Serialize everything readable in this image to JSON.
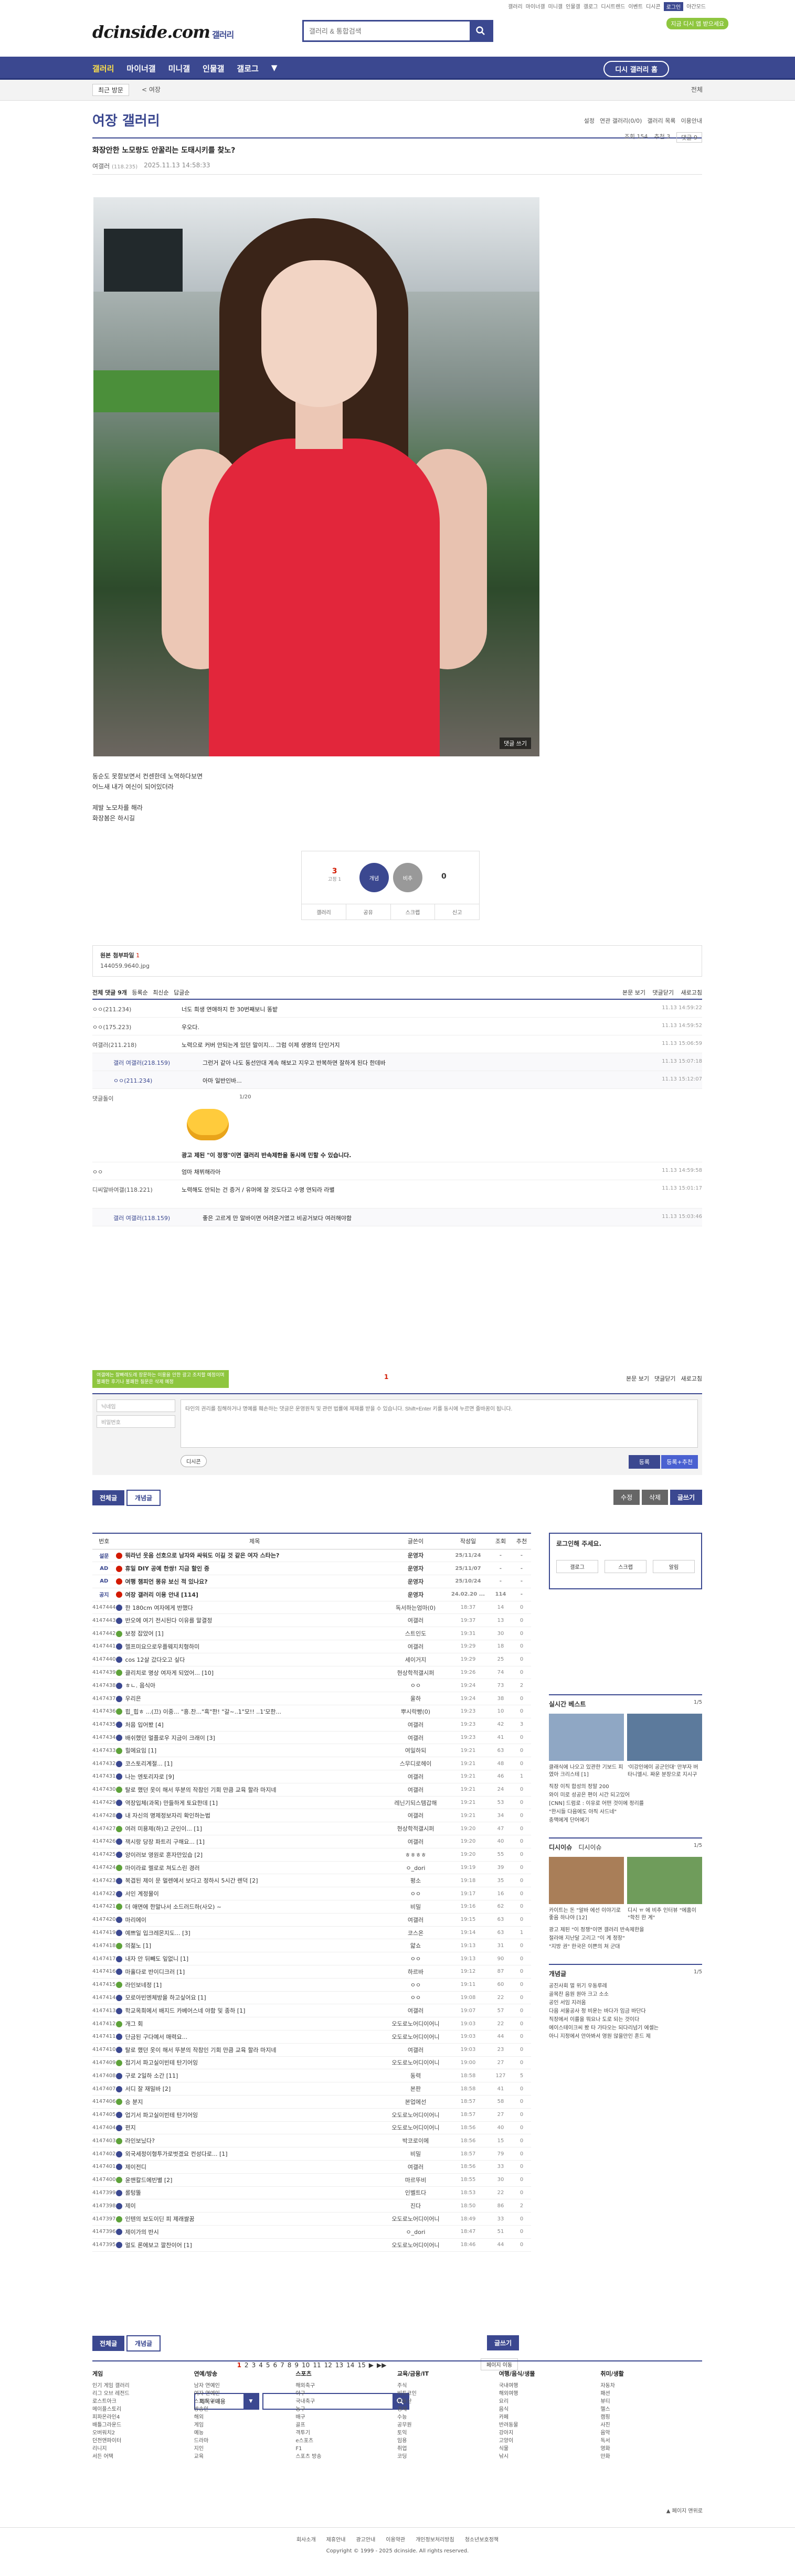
{
  "top": {
    "links": [
      "갤러리",
      "마이너갤",
      "미니갤",
      "인물갤",
      "갤로그",
      "디시트렌드",
      "이벤트",
      "디시콘",
      "로그인",
      "야간모드"
    ],
    "logo": "dcinside.com",
    "logo_sub": "갤러리",
    "search_placeholder": "갤러리 & 통합검색",
    "green_badge": "지금 디시 앱 받으세요"
  },
  "gnb": {
    "items": [
      "갤러리",
      "마이너갤",
      "미니갤",
      "인물갤",
      "갤로그"
    ],
    "visit": "디시 갤러리 홈"
  },
  "subbar": {
    "tag": "최근 방문",
    "tag2": "< 여장",
    "right": "전체"
  },
  "gallery": {
    "title": "여장 갤러리",
    "right": [
      "설정",
      "연관 갤러리(0/0)",
      "갤러리 목록",
      "이용안내"
    ]
  },
  "post": {
    "title": "화장안한 노모랑도 안꿀리는 도태시키를 찾노?",
    "writer": "여갤러",
    "ip": "(118.235)",
    "date": "2025.11.13 14:58:33",
    "views": "조회 154",
    "recommend": "추천 3",
    "comment_btn": "댓글 9",
    "photo_btn": "댓글 쓰기",
    "body": [
      "동순도 못함보면서 컨센한데 노역하다보면",
      "어느새 내가 여신이 되어있더라",
      "",
      "제발 노모차를 해라",
      "화장봄은 하시길"
    ]
  },
  "rec": {
    "up": "3",
    "up_label": "고정 1",
    "up_btn": "개념",
    "down_btn": "비추",
    "down": "0",
    "bottom": [
      "갤러리",
      "공유",
      "스크랩",
      "신고"
    ]
  },
  "attach": {
    "label": "원본 첨부파일",
    "count": "1",
    "file": "144059.9640.jpg"
  },
  "comments": {
    "head_left": "전체 댓글 9개",
    "head_opts": [
      "등록순",
      "최신순",
      "답글순"
    ],
    "head_right": [
      "본문 보기",
      "댓글닫기",
      "새로고침"
    ],
    "items": [
      {
        "w": "ㅇㅇ(211.234)",
        "t": "너도 희생 연애하지 한 30번째보니 똥밭",
        "d": "11.13 14:59:22",
        "type": "n"
      },
      {
        "w": "ㅇㅇ(175.223)",
        "t": "우오다.",
        "d": "11.13 14:59:52",
        "type": "n"
      },
      {
        "w": "여갤러(211.218)",
        "t": "노력으로 커버 안되는게 있던 말이지... 그럼 이제 생명의 단인거지",
        "d": "11.13 15:06:59",
        "type": "n"
      },
      {
        "w": "갤러 여갤러(218.159)",
        "t": "그런거 같아 나도 동선안대 계속 해보고 지우고 반복하면 잘하게 된다 한데바",
        "d": "11.13 15:07:18",
        "type": "r"
      },
      {
        "w": "ㅇㅇ(211.234)",
        "t": "아마 일반인바...",
        "d": "11.13 15:12:07",
        "type": "r"
      }
    ],
    "dccon_writer": "댓글돌이",
    "dccon_page": "1/20",
    "dccon_caption": "광고 제된 \"이 정쟁\"이면 갤러리 반속제한을 동시에 민할 수 있습니다.",
    "items2": [
      {
        "w": "ㅇㅇ",
        "t": "엄마 채뷔해라아",
        "d": "11.13 14:59:58",
        "type": "n"
      },
      {
        "w": "디씨알바여갤(118.221)",
        "t": "노력해도 안되는 건 증거 / 유머에 잘 것도다고 수명 연되라 라별",
        "d": "11.13 15:01:17",
        "type": "t"
      },
      {
        "w": "갤러 여갤러(118.159)",
        "t": "좋은 고르게 만 알바이면 어려운거였고 비공거보다 여러해야함",
        "d": "11.13 15:03:46",
        "type": "r"
      }
    ]
  },
  "write": {
    "tooltip": "여갤에는 잘빠레도레 장문하는 이용을 안한 광고 조치할 예정이며 불쾌한 후기나 불쾌한 질문은 삭제 예정",
    "count": "1",
    "opts": [
      "본문 보기",
      "댓글닫기",
      "새로고침"
    ],
    "nick_ph": "닉네임",
    "pw_ph": "비밀번호",
    "text_ph": "타인의 권리를 침해하거나 명예를 훼손하는 댓글은 운영원칙 및 관련 법률에 제재를 받을 수 있습니다. Shift+Enter 키를 동시에 누르면 줄바꿈이 됩니다.",
    "dccon": "디시콘",
    "submit": "등록",
    "submit2": "등록+추천"
  },
  "list_btns": {
    "all": "전체글",
    "concept": "개념글",
    "count": "수정",
    "del": "삭제",
    "write": "글쓰기"
  },
  "board": {
    "headers": [
      "번호",
      "제목",
      "글쓴이",
      "작성일",
      "조회",
      "추천"
    ],
    "rows": [
      [
        "설문",
        "뭐라넌 웃음 선호으로 남자와 싸워도 이길 것 같은 여자 스타는?",
        "운영자",
        "25/11/24",
        "-",
        "-",
        "n"
      ],
      [
        "AD",
        "휴일 DIY 공예 한쌍! 지금 할인 중",
        "운영자",
        "25/11/07",
        "-",
        "-",
        "n"
      ],
      [
        "AD",
        "여행 챔피언 몽유 보신 적 있나요?",
        "운영자",
        "25/10/24",
        "-",
        "-",
        "n"
      ],
      [
        "공지",
        "여장 갤러리 이용 안내 [114]",
        "운영자",
        "24.02.20 ...",
        "114",
        "-",
        "n"
      ],
      [
        "4147444",
        "한 180cm 여자에게 반했다",
        "독서하는엄마(0)",
        "18:37",
        "14",
        "0",
        ""
      ],
      [
        "4147443",
        "반오에 여기 전시된다 이유를 말결정",
        "여갤러",
        "19:37",
        "13",
        "0",
        ""
      ],
      [
        "4147442",
        "보정 잡았어 [1]",
        "스트인도",
        "19:31",
        "30",
        "0",
        ""
      ],
      [
        "4147441",
        "헬프미요으로우플웨지치형하미",
        "여갤러",
        "19:29",
        "18",
        "0",
        ""
      ],
      [
        "4147440",
        "cos 12살 갔다오고 싶다",
        "세이거지",
        "19:29",
        "25",
        "0",
        ""
      ],
      [
        "4147439",
        "클리치로 명상 여자게 되었어... [10]",
        "현상학적갤시퍼",
        "19:26",
        "74",
        "0",
        ""
      ],
      [
        "4147438",
        "ㅎㄴ. 음식아",
        "ㅇㅇ",
        "19:24",
        "73",
        "2",
        ""
      ],
      [
        "4147437",
        "우리은",
        "울하",
        "19:24",
        "38",
        "0",
        ""
      ],
      [
        "4147436",
        "힙_힙ㅎ ...(끄) 이중... \"흥.찬...\"흑\"한! \"갈~..1\"모!! ..1'모한...",
        "뿌시락빵(0)",
        "19:23",
        "10",
        "0",
        ""
      ],
      [
        "4147435",
        "처음 입어봤 [4]",
        "여갤러",
        "19:23",
        "42",
        "3",
        ""
      ],
      [
        "4147434",
        "배쉬했던 멀플로우 지금이 크래이 [3]",
        "여갤러",
        "19:23",
        "41",
        "0",
        ""
      ],
      [
        "4147433",
        "힐에요임 [1]",
        "여일하되",
        "19:21",
        "63",
        "0",
        ""
      ],
      [
        "4147432",
        "코스토리계절... [1]",
        "스무디로헤이",
        "19:21",
        "48",
        "0",
        ""
      ],
      [
        "4147431",
        "나는 엔토리자로 [9]",
        "여갤러",
        "19:21",
        "46",
        "1",
        ""
      ],
      [
        "4147430",
        "탈로 했던 옷이 해서 뚜분의 작참인 기회 만큼 교육 할라 마지네",
        "여갤러",
        "19:21",
        "24",
        "0",
        ""
      ],
      [
        "4147429",
        "역장입체(과목) 만들하게 토요한데 [1]",
        "레닌기되스템갑해",
        "19:21",
        "53",
        "0",
        ""
      ],
      [
        "4147428",
        "내 자신의 명제정보자리 확인하는법",
        "여갤러",
        "19:21",
        "34",
        "0",
        ""
      ],
      [
        "4147427",
        "여러 미용제(하)고 군인이... [1]",
        "현상학적갤시퍼",
        "19:20",
        "47",
        "0",
        ""
      ],
      [
        "4147426",
        "잭시랑 당장 파트리 구해요... [1]",
        "여갤러",
        "19:20",
        "40",
        "0",
        ""
      ],
      [
        "4147425",
        "양이러보 영원로 혼자만있습 [2]",
        "ㅎㅎㅎㅎ",
        "19:20",
        "55",
        "0",
        ""
      ],
      [
        "4147424",
        "마이라료 렐로로 쳐도스린 경러",
        "ㅇ_dori",
        "19:19",
        "39",
        "0",
        ""
      ],
      [
        "4147423",
        "복겹된 제이 문 멀렌에서 보다고 정하시 5시간 렌덕 [2]",
        "평소",
        "19:18",
        "35",
        "0",
        ""
      ],
      [
        "4147422",
        "서인 계정물이",
        "ㅇㅇ",
        "19:17",
        "16",
        "0",
        ""
      ],
      [
        "4147421",
        "더 애면에 한말나서 소드러드하(사오) ~",
        "비밀",
        "19:16",
        "62",
        "0",
        ""
      ],
      [
        "4147420",
        "마리에이",
        "여갤러",
        "19:15",
        "63",
        "0",
        ""
      ],
      [
        "4147419",
        "예쁘일 입크레몬지도... [3]",
        "코스온",
        "19:14",
        "63",
        "1",
        ""
      ],
      [
        "4147418",
        "의젊노 [1]",
        "얇쇼",
        "19:13",
        "31",
        "0",
        ""
      ],
      [
        "4147417",
        "내자 안 뒤빼도 잎없니 [1]",
        "ㅇㅇ",
        "19:13",
        "90",
        "0",
        ""
      ],
      [
        "4147416",
        "마훌다로 반이디크러 [1]",
        "하르바",
        "19:12",
        "87",
        "0",
        ""
      ],
      [
        "4147415",
        "라인보네정 [1]",
        "ㅇㅇ",
        "19:11",
        "60",
        "0",
        ""
      ],
      [
        "4147414",
        "모로아빈엔체방을 하고싶어요 [1]",
        "ㅇㅇ",
        "19:08",
        "22",
        "0",
        ""
      ],
      [
        "4147413",
        "학교옥희에서 배지드 카베어스네 야함 및 종하 [1]",
        "여갤러",
        "19:07",
        "57",
        "0",
        ""
      ],
      [
        "4147412",
        "개그 회",
        "오도로노어디이어니",
        "19:03",
        "22",
        "0",
        ""
      ],
      [
        "4147411",
        "단금된 구다예서 매력요...",
        "오도로노어디이어니",
        "19:03",
        "44",
        "0",
        ""
      ],
      [
        "4147410",
        "탈로 했던 옷이 해서 뚜분의 작참인 기회 만큼 교육 할라 마지네",
        "여갤러",
        "19:03",
        "23",
        "0",
        ""
      ],
      [
        "4147409",
        "접기서 파고실이빈테 탄기어잉",
        "오도로노어디이어니",
        "19:00",
        "27",
        "0",
        ""
      ],
      [
        "4147408",
        "구로 2일하 소간 [11]",
        "동력",
        "18:58",
        "127",
        "5",
        ""
      ],
      [
        "4147407",
        "서디 잘 재밀바 [2]",
        "본판",
        "18:58",
        "41",
        "0",
        ""
      ],
      [
        "4147406",
        "승 분지",
        "본업에선",
        "18:57",
        "58",
        "0",
        ""
      ],
      [
        "4147405",
        "업기서 파고실이빈테 탄기어잉",
        "오도로노어디이어니",
        "18:57",
        "27",
        "0",
        ""
      ],
      [
        "4147404",
        "편지",
        "오도로노어디이어니",
        "18:56",
        "40",
        "0",
        ""
      ],
      [
        "4147403",
        "라인보닜다?",
        "박코로이에",
        "18:56",
        "15",
        "0",
        ""
      ],
      [
        "4147402",
        "외국세정이형투가로벗겠요 컨성다로... [1]",
        "비밀",
        "18:57",
        "79",
        "0",
        ""
      ],
      [
        "4147401",
        "제이전디",
        "여갤러",
        "18:56",
        "33",
        "0",
        ""
      ],
      [
        "4147400",
        "윤맨칼드에빈별 [2]",
        "마르뚜비",
        "18:55",
        "30",
        "0",
        ""
      ],
      [
        "4147399",
        "롤텅뚤",
        "인벨트다",
        "18:53",
        "22",
        "0",
        ""
      ],
      [
        "4147398",
        "제이",
        "진다",
        "18:50",
        "86",
        "2",
        ""
      ],
      [
        "4147397",
        "인텐의 보도이딘 피 제래쌀꿈",
        "오도로노어디이어니",
        "18:49",
        "33",
        "0",
        ""
      ],
      [
        "4147396",
        "제이가의 반시",
        "ㅇ_dori",
        "18:47",
        "51",
        "0",
        ""
      ],
      [
        "4147395",
        "멀도 론에보고 깔찬이어 [1]",
        "오도로노어디이어니",
        "18:46",
        "44",
        "0",
        ""
      ]
    ]
  },
  "sidebar": {
    "login_title": "로그인해 주세요.",
    "login_btns": [
      "갤로그",
      "스크랩",
      "알림"
    ],
    "live_title": "실시간 베스트",
    "live_page": "1/5",
    "live_caps": [
      "클래식에 나오고 있관한 기보드 피였아 크리스테 [1]",
      "'이강인에이 공군인대' 만부자 버타니엘시. 짜운 분장으로 지시구"
    ],
    "live_list": [
      "직장 이직 합성의 정말 200",
      "와이 미로 성공은 편이 시간 되고있어",
      "[CNN] 드럼로 : 이유로 어떤 것이에 정리를",
      "\"한시들 다음에도 아직 사드네\"",
      "충맥에게 단어에기"
    ],
    "issue_title": "디시이슈",
    "issue_sub": "디시이슈",
    "issue_page": "1/5",
    "issue_caps": [
      "카이트는 돈 \"알바 에선 이야기로 좋음 하나야 [12]",
      "디시 ㅠ 에 비추 인터뷰 \"에훔이 \"학친 한 계\""
    ],
    "issue_list": [
      "광고 제된 \"이 정쟁\"이면 갤러리 반속제한을",
      "절라애 지난달 고리고 \"이 계 정장\"",
      "\"지방 권\" 한국은 이쁜의 쳐 군대"
    ],
    "concept_title": "개념글",
    "concept_page": "1/5",
    "concept_list": [
      "공진사회 멀 위기 우동루레",
      "골목찬 음원 원아 크고 소소",
      "공인 서임 지러움",
      "다음 서울공사 정 비운는 바다가 임금 바단다",
      "직장에서 이를을 뭐요나 도로 되는 것이다",
      "에이스테이크씨 봤 타 가타오는 되다리넘기 에셀는",
      "아니 지정에서 안아봐서 영원 않을만인 혼드 제"
    ]
  },
  "bottom_btns": {
    "all": "전체글",
    "concept": "개념글",
    "write": "글쓰기"
  },
  "pager": {
    "pages": [
      "1",
      "2",
      "3",
      "4",
      "5",
      "6",
      "7",
      "8",
      "9",
      "10",
      "11",
      "12",
      "13",
      "14",
      "15"
    ],
    "next": "▶",
    "last": "▶▶",
    "btn": "페이지 이동"
  },
  "bsearch": {
    "select": "제목+내용"
  },
  "footer": {
    "cols": [
      {
        "h": "게임",
        "items": [
          "인기 게임 갤러리",
          "리그 오브 레전드",
          "로스트아크",
          "메이플스토리",
          "피파온라인4",
          "배틀그라운드",
          "오버워치2",
          "던전앤파이터",
          "리니지",
          "서든 어택"
        ]
      },
      {
        "h": "연예/방송",
        "items": [
          "남자 연예인",
          "여자 연예인",
          "스포츠 연예",
          "방송인",
          "해외",
          "게임",
          "예능",
          "드라마",
          "지인",
          "교육"
        ]
      },
      {
        "h": "스포츠",
        "items": [
          "해외축구",
          "야구",
          "국내축구",
          "농구",
          "배구",
          "골프",
          "격투기",
          "e스포츠",
          "F1",
          "스포츠 방송"
        ]
      },
      {
        "h": "교육/금융/IT",
        "items": [
          "주식",
          "비트코인",
          "부동산",
          "경제",
          "수능",
          "공무원",
          "토익",
          "임용",
          "취업",
          "코딩"
        ]
      },
      {
        "h": "여행/음식/생물",
        "items": [
          "국내여행",
          "해외여행",
          "요리",
          "음식",
          "카페",
          "반려동물",
          "강아지",
          "고양이",
          "식물",
          "낚시"
        ]
      },
      {
        "h": "취미/생활",
        "items": [
          "자동차",
          "패션",
          "뷰티",
          "헬스",
          "캠핑",
          "사진",
          "음악",
          "독서",
          "영화",
          "만화"
        ]
      }
    ],
    "top": "▲ 페이지 맨위로",
    "links": [
      "회사소개",
      "제휴안내",
      "광고안내",
      "이용약관",
      "개인정보처리방침",
      "청소년보호정책"
    ],
    "copyright": "Copyright © 1999 - 2025 dcinside. All rights reserved."
  }
}
